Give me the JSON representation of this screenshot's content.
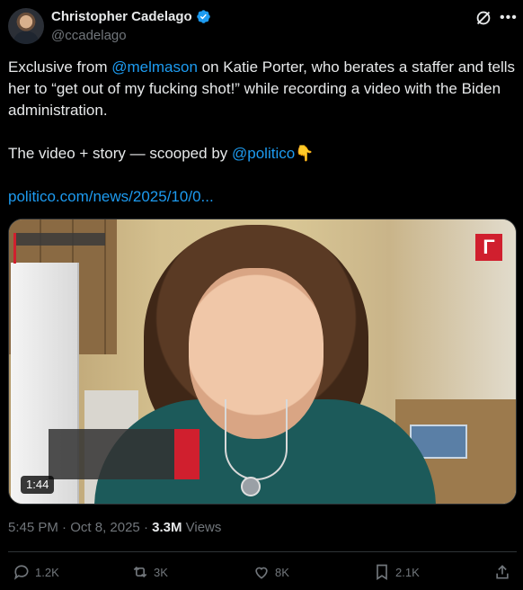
{
  "author": {
    "name": "Christopher Cadelago",
    "handle": "@ccadelago"
  },
  "tweet": {
    "paragraph1": {
      "before": "Exclusive from ",
      "mention": "@melmason",
      "after": " on Katie Porter, who berates a staffer and tells her to “get out of my fucking shot!” while recording a video with the Biden administration."
    },
    "paragraph2": {
      "before": "The video + story — scooped by ",
      "mention": "@politico",
      "emoji": "👇"
    },
    "link": "politico.com/news/2025/10/0..."
  },
  "media": {
    "duration": "1:44",
    "logo_text": "Γ"
  },
  "meta": {
    "time": "5:45 PM",
    "sep": " · ",
    "date": "Oct 8, 2025",
    "sep2": " · ",
    "views_count": "3.3M",
    "views_label": " Views"
  },
  "actions": {
    "replies": "1.2K",
    "reposts": "3K",
    "likes": "8K",
    "bookmarks": "2.1K"
  },
  "colors": {
    "accent": "#1d9bf0",
    "muted": "#71767b",
    "text": "#e7e9ea",
    "background": "#000000",
    "brand_red": "#d01f2e"
  },
  "icons": [
    "verified-badge-icon",
    "grok-icon",
    "more-icon",
    "reply-icon",
    "repost-icon",
    "like-icon",
    "bookmark-icon",
    "share-icon"
  ]
}
